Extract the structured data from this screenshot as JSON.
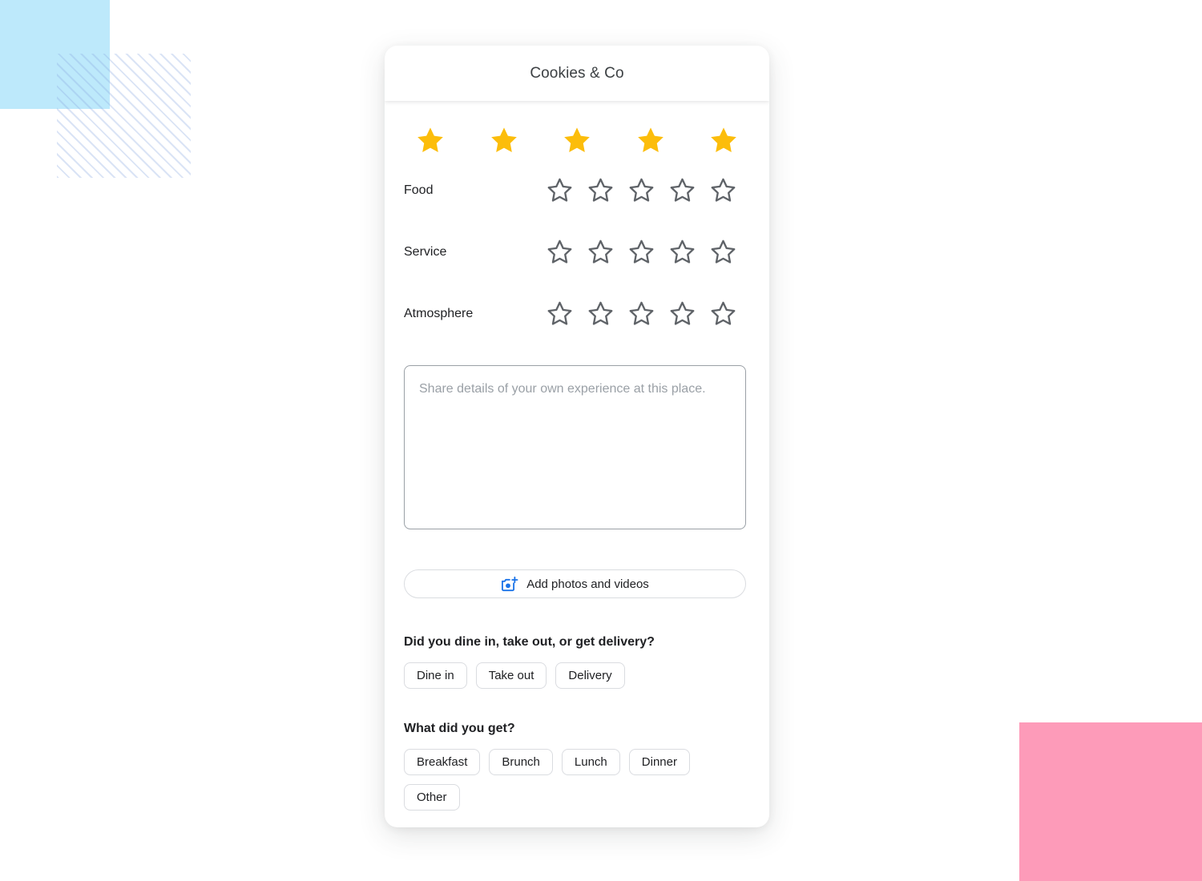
{
  "decor": {
    "blue_square_color": "#bde9fb",
    "striped_square_color": "#8caae1",
    "pink_rect_color": "#fd9bb9"
  },
  "card": {
    "title": "Cookies & Co"
  },
  "overall_rating": {
    "value": 5,
    "max": 5,
    "filled_color": "#fcbd0b",
    "stars": [
      {
        "name": "overall-star-1",
        "filled": true
      },
      {
        "name": "overall-star-2",
        "filled": true
      },
      {
        "name": "overall-star-3",
        "filled": true
      },
      {
        "name": "overall-star-4",
        "filled": true
      },
      {
        "name": "overall-star-5",
        "filled": true
      }
    ]
  },
  "categories": [
    {
      "label": "Food",
      "value": 0,
      "max": 5
    },
    {
      "label": "Service",
      "value": 0,
      "max": 5
    },
    {
      "label": "Atmosphere",
      "value": 0,
      "max": 5
    }
  ],
  "review": {
    "placeholder": "Share details of your own experience at this place.",
    "value": ""
  },
  "add_media": {
    "label": "Add photos and videos",
    "icon": "camera-plus-icon",
    "icon_color": "#1a73e8"
  },
  "questions": [
    {
      "prompt": "Did you dine in, take out, or get delivery?",
      "options": [
        "Dine in",
        "Take out",
        "Delivery"
      ]
    },
    {
      "prompt": "What did you get?",
      "options": [
        "Breakfast",
        "Brunch",
        "Lunch",
        "Dinner",
        "Other"
      ]
    }
  ],
  "outline_star_color": "#5f6368"
}
